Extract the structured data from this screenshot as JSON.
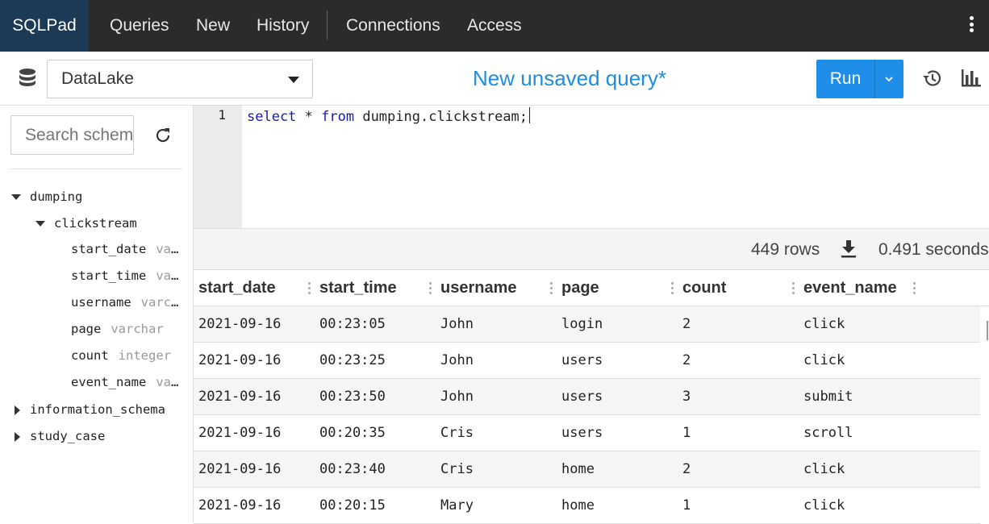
{
  "nav": {
    "brand": "SQLPad",
    "items": [
      "Queries",
      "New",
      "History",
      "Connections",
      "Access"
    ]
  },
  "toolbar": {
    "connection": "DataLake",
    "query_title": "New unsaved query*",
    "run_label": "Run"
  },
  "sidebar": {
    "search_placeholder": "Search schema",
    "schemas": [
      {
        "name": "dumping",
        "expanded": true,
        "tables": [
          {
            "name": "clickstream",
            "expanded": true,
            "columns": [
              {
                "name": "start_date",
                "type": "varchar"
              },
              {
                "name": "start_time",
                "type": "varchar"
              },
              {
                "name": "username",
                "type": "varchar"
              },
              {
                "name": "page",
                "type": "varchar"
              },
              {
                "name": "count",
                "type": "integer"
              },
              {
                "name": "event_name",
                "type": "varchar"
              }
            ]
          }
        ]
      },
      {
        "name": "information_schema",
        "expanded": false
      },
      {
        "name": "study_case",
        "expanded": false
      }
    ]
  },
  "editor": {
    "line_number": "1",
    "kw_select": "select",
    "star": " * ",
    "kw_from": "from",
    "rest": " dumping.clickstream;"
  },
  "results": {
    "rows_label": "449 rows",
    "time_label": "0.491 seconds",
    "columns": [
      "start_date",
      "start_time",
      "username",
      "page",
      "count",
      "event_name"
    ],
    "rows": [
      [
        "2021-09-16",
        "00:23:05",
        "John",
        "login",
        "2",
        "click"
      ],
      [
        "2021-09-16",
        "00:23:25",
        "John",
        "users",
        "2",
        "click"
      ],
      [
        "2021-09-16",
        "00:23:50",
        "John",
        "users",
        "3",
        "submit"
      ],
      [
        "2021-09-16",
        "00:20:35",
        "Cris",
        "users",
        "1",
        "scroll"
      ],
      [
        "2021-09-16",
        "00:23:40",
        "Cris",
        "home",
        "2",
        "click"
      ],
      [
        "2021-09-16",
        "00:20:15",
        "Mary",
        "home",
        "1",
        "click"
      ]
    ]
  },
  "icons": {
    "database": "database-icon",
    "refresh": "refresh-icon",
    "history": "history-icon",
    "chart": "bar-chart-icon",
    "download": "download-icon",
    "more": "kebab-menu-icon"
  },
  "colors": {
    "nav_bg": "#2b2b2b",
    "brand_bg": "#1c3a55",
    "accent": "#1f8ee8",
    "title": "#1e8ddc"
  }
}
